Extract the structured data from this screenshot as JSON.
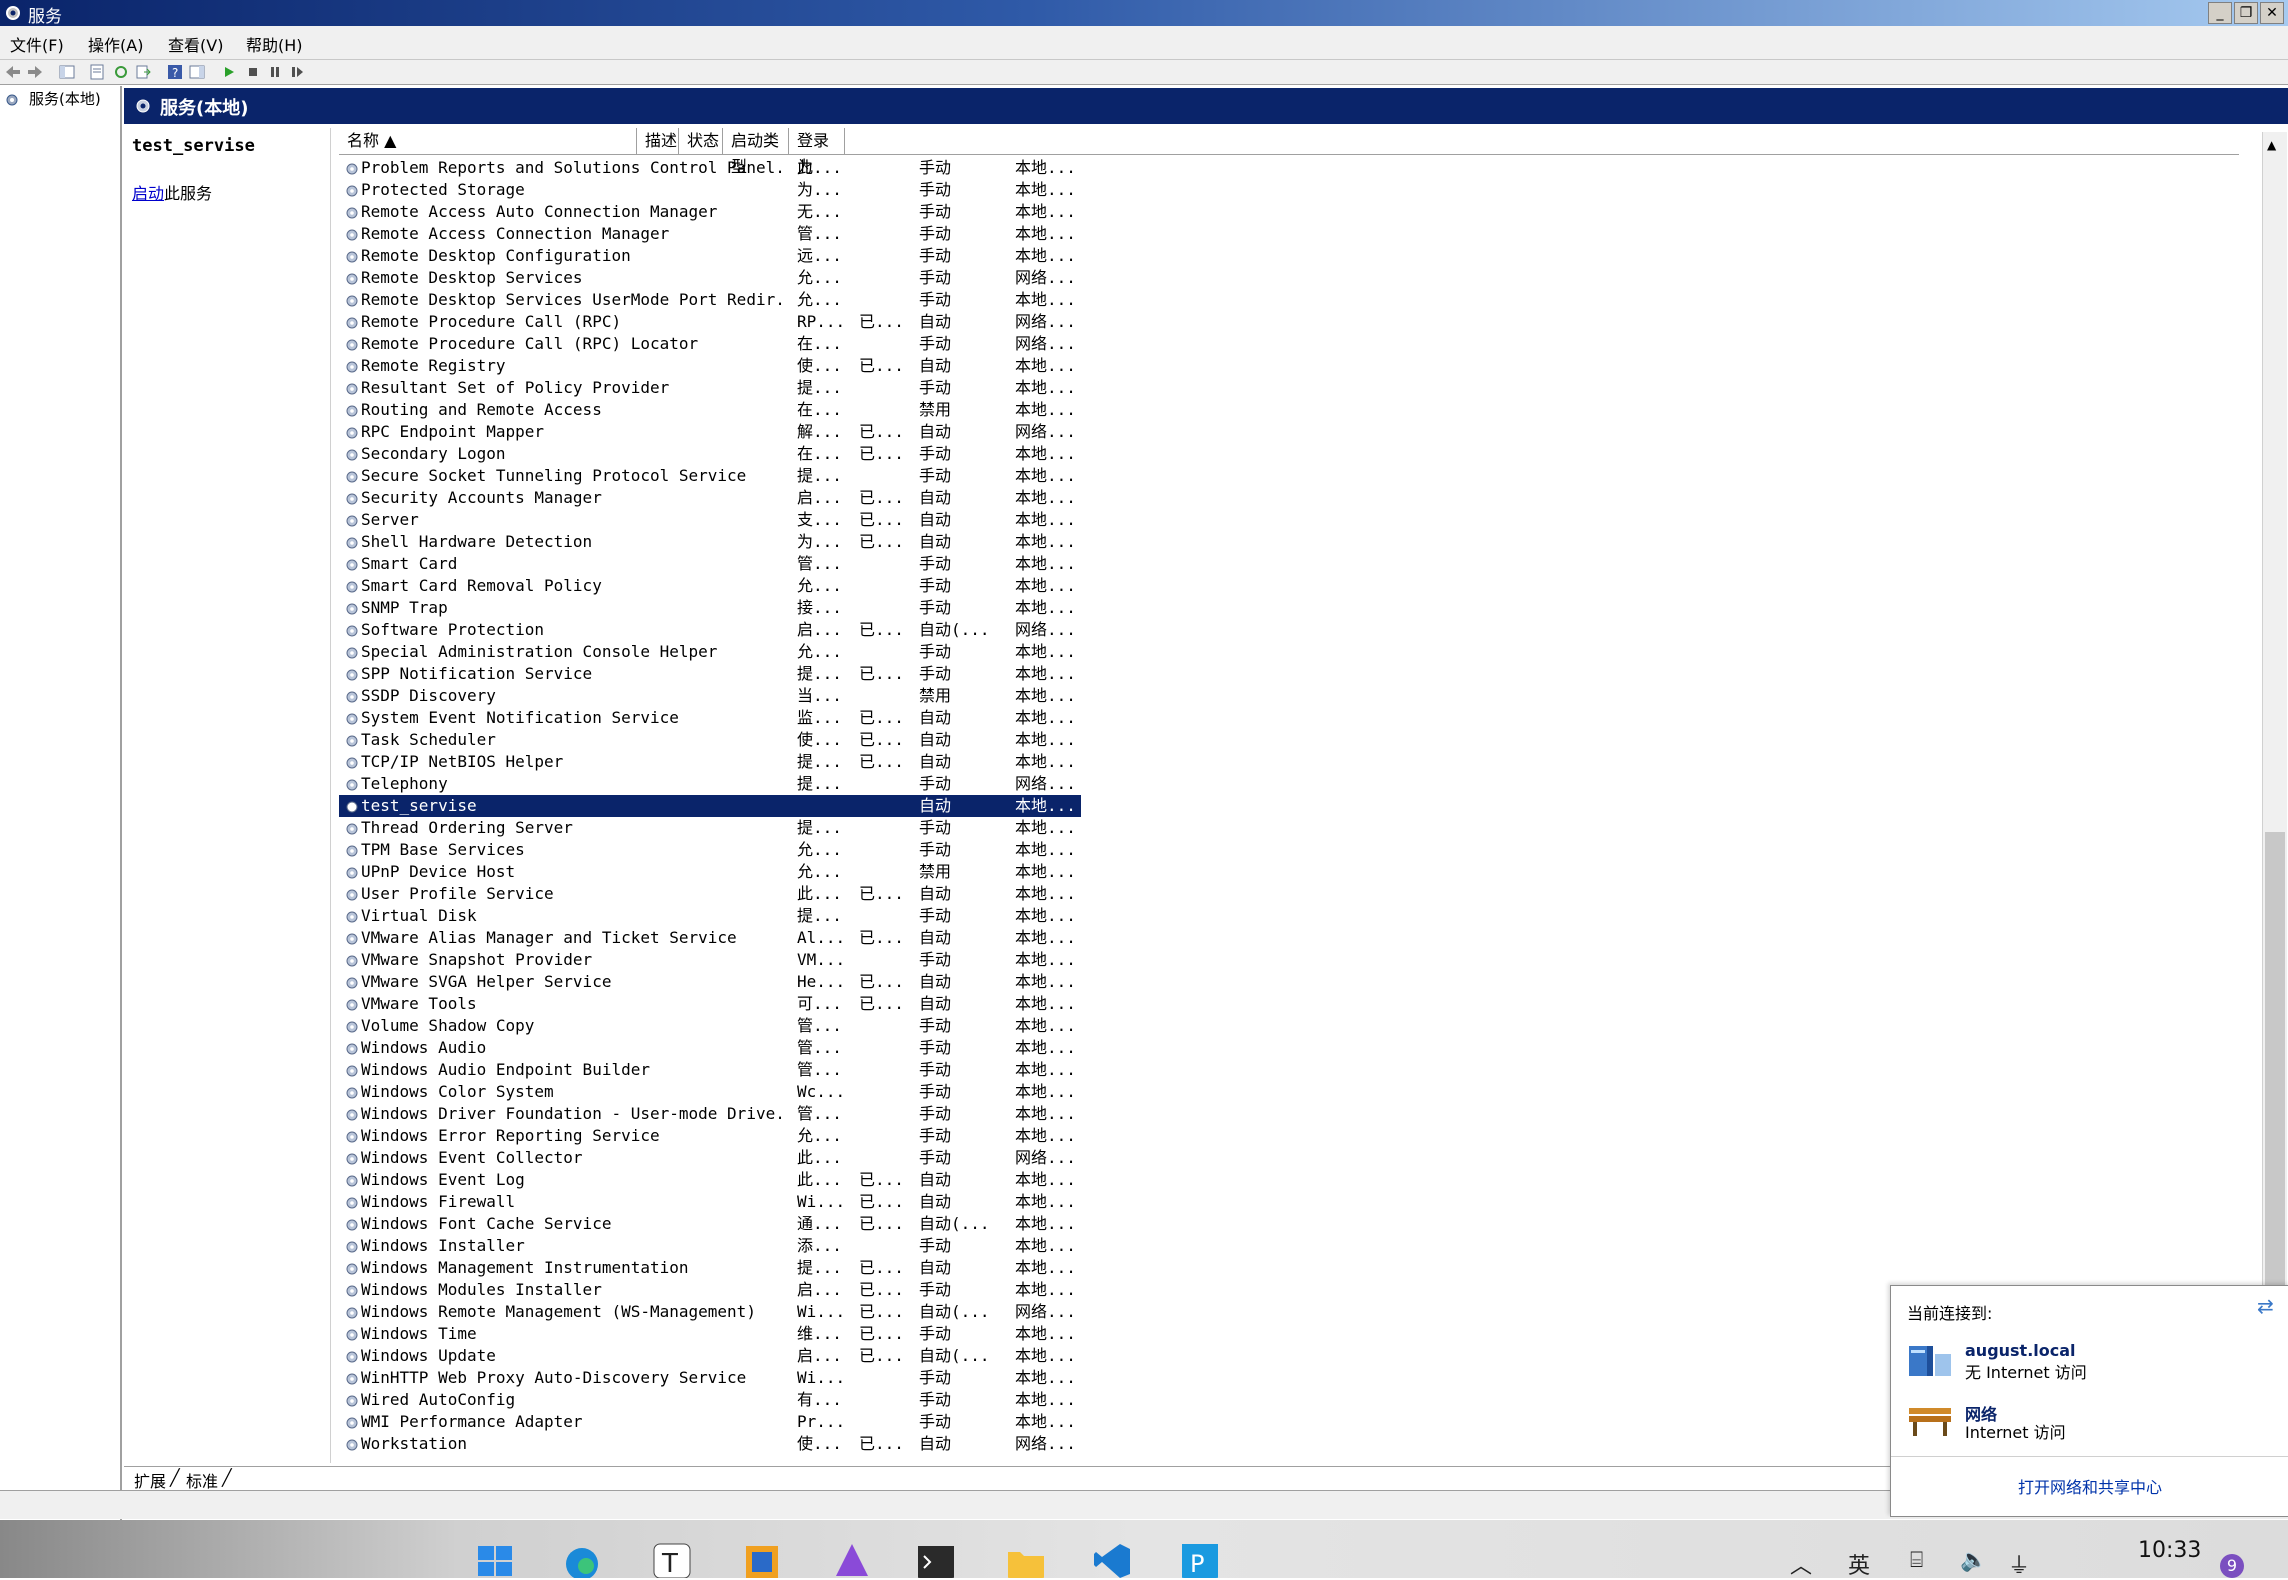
{
  "window": {
    "title": "服务",
    "controls": {
      "minimize": "_",
      "restore": "❐",
      "close": "✕"
    }
  },
  "menu": [
    "文件(F)",
    "操作(A)",
    "查看(V)",
    "帮助(H)"
  ],
  "tree": {
    "root": "服务(本地)"
  },
  "header": {
    "title": "服务(本地)"
  },
  "description": {
    "service_name": "test_servise",
    "start_link": "启动",
    "start_suffix": "此服务"
  },
  "columns": {
    "name": "名称 ▲",
    "desc": "描述",
    "status": "状态",
    "startup": "启动类型",
    "logon": "登录为"
  },
  "services": [
    {
      "name": "Problem Reports and Solutions Control Panel...",
      "desc": "此...",
      "status": "",
      "startup": "手动",
      "logon": "本地..."
    },
    {
      "name": "Protected Storage",
      "desc": "为...",
      "status": "",
      "startup": "手动",
      "logon": "本地..."
    },
    {
      "name": "Remote Access Auto Connection Manager",
      "desc": "无...",
      "status": "",
      "startup": "手动",
      "logon": "本地..."
    },
    {
      "name": "Remote Access Connection Manager",
      "desc": "管...",
      "status": "",
      "startup": "手动",
      "logon": "本地..."
    },
    {
      "name": "Remote Desktop Configuration",
      "desc": "远...",
      "status": "",
      "startup": "手动",
      "logon": "本地..."
    },
    {
      "name": "Remote Desktop Services",
      "desc": "允...",
      "status": "",
      "startup": "手动",
      "logon": "网络..."
    },
    {
      "name": "Remote Desktop Services UserMode Port Redir...",
      "desc": "允...",
      "status": "",
      "startup": "手动",
      "logon": "本地..."
    },
    {
      "name": "Remote Procedure Call (RPC)",
      "desc": "RP...",
      "status": "已...",
      "startup": "自动",
      "logon": "网络..."
    },
    {
      "name": "Remote Procedure Call (RPC) Locator",
      "desc": "在...",
      "status": "",
      "startup": "手动",
      "logon": "网络..."
    },
    {
      "name": "Remote Registry",
      "desc": "使...",
      "status": "已...",
      "startup": "自动",
      "logon": "本地..."
    },
    {
      "name": "Resultant Set of Policy Provider",
      "desc": "提...",
      "status": "",
      "startup": "手动",
      "logon": "本地..."
    },
    {
      "name": "Routing and Remote Access",
      "desc": "在...",
      "status": "",
      "startup": "禁用",
      "logon": "本地..."
    },
    {
      "name": "RPC Endpoint Mapper",
      "desc": "解...",
      "status": "已...",
      "startup": "自动",
      "logon": "网络..."
    },
    {
      "name": "Secondary Logon",
      "desc": "在...",
      "status": "已...",
      "startup": "手动",
      "logon": "本地..."
    },
    {
      "name": "Secure Socket Tunneling Protocol Service",
      "desc": "提...",
      "status": "",
      "startup": "手动",
      "logon": "本地..."
    },
    {
      "name": "Security Accounts Manager",
      "desc": "启...",
      "status": "已...",
      "startup": "自动",
      "logon": "本地..."
    },
    {
      "name": "Server",
      "desc": "支...",
      "status": "已...",
      "startup": "自动",
      "logon": "本地..."
    },
    {
      "name": "Shell Hardware Detection",
      "desc": "为...",
      "status": "已...",
      "startup": "自动",
      "logon": "本地..."
    },
    {
      "name": "Smart Card",
      "desc": "管...",
      "status": "",
      "startup": "手动",
      "logon": "本地..."
    },
    {
      "name": "Smart Card Removal Policy",
      "desc": "允...",
      "status": "",
      "startup": "手动",
      "logon": "本地..."
    },
    {
      "name": "SNMP Trap",
      "desc": "接...",
      "status": "",
      "startup": "手动",
      "logon": "本地..."
    },
    {
      "name": "Software Protection",
      "desc": "启...",
      "status": "已...",
      "startup": "自动(...",
      "logon": "网络..."
    },
    {
      "name": "Special Administration Console Helper",
      "desc": "允...",
      "status": "",
      "startup": "手动",
      "logon": "本地..."
    },
    {
      "name": "SPP Notification Service",
      "desc": "提...",
      "status": "已...",
      "startup": "手动",
      "logon": "本地..."
    },
    {
      "name": "SSDP Discovery",
      "desc": "当...",
      "status": "",
      "startup": "禁用",
      "logon": "本地..."
    },
    {
      "name": "System Event Notification Service",
      "desc": "监...",
      "status": "已...",
      "startup": "自动",
      "logon": "本地..."
    },
    {
      "name": "Task Scheduler",
      "desc": "使...",
      "status": "已...",
      "startup": "自动",
      "logon": "本地..."
    },
    {
      "name": "TCP/IP NetBIOS Helper",
      "desc": "提...",
      "status": "已...",
      "startup": "自动",
      "logon": "本地..."
    },
    {
      "name": "Telephony",
      "desc": "提...",
      "status": "",
      "startup": "手动",
      "logon": "网络..."
    },
    {
      "name": "test_servise",
      "desc": "",
      "status": "",
      "startup": "自动",
      "logon": "本地...",
      "selected": true
    },
    {
      "name": "Thread Ordering Server",
      "desc": "提...",
      "status": "",
      "startup": "手动",
      "logon": "本地..."
    },
    {
      "name": "TPM Base Services",
      "desc": "允...",
      "status": "",
      "startup": "手动",
      "logon": "本地..."
    },
    {
      "name": "UPnP Device Host",
      "desc": "允...",
      "status": "",
      "startup": "禁用",
      "logon": "本地..."
    },
    {
      "name": "User Profile Service",
      "desc": "此...",
      "status": "已...",
      "startup": "自动",
      "logon": "本地..."
    },
    {
      "name": "Virtual Disk",
      "desc": "提...",
      "status": "",
      "startup": "手动",
      "logon": "本地..."
    },
    {
      "name": "VMware Alias Manager and Ticket Service",
      "desc": "Al...",
      "status": "已...",
      "startup": "自动",
      "logon": "本地..."
    },
    {
      "name": "VMware Snapshot Provider",
      "desc": "VM...",
      "status": "",
      "startup": "手动",
      "logon": "本地..."
    },
    {
      "name": "VMware SVGA Helper Service",
      "desc": "He...",
      "status": "已...",
      "startup": "自动",
      "logon": "本地..."
    },
    {
      "name": "VMware Tools",
      "desc": "可...",
      "status": "已...",
      "startup": "自动",
      "logon": "本地..."
    },
    {
      "name": "Volume Shadow Copy",
      "desc": "管...",
      "status": "",
      "startup": "手动",
      "logon": "本地..."
    },
    {
      "name": "Windows Audio",
      "desc": "管...",
      "status": "",
      "startup": "手动",
      "logon": "本地..."
    },
    {
      "name": "Windows Audio Endpoint Builder",
      "desc": "管...",
      "status": "",
      "startup": "手动",
      "logon": "本地..."
    },
    {
      "name": "Windows Color System",
      "desc": "Wc...",
      "status": "",
      "startup": "手动",
      "logon": "本地..."
    },
    {
      "name": "Windows Driver Foundation - User-mode Drive...",
      "desc": "管...",
      "status": "",
      "startup": "手动",
      "logon": "本地..."
    },
    {
      "name": "Windows Error Reporting Service",
      "desc": "允...",
      "status": "",
      "startup": "手动",
      "logon": "本地..."
    },
    {
      "name": "Windows Event Collector",
      "desc": "此...",
      "status": "",
      "startup": "手动",
      "logon": "网络..."
    },
    {
      "name": "Windows Event Log",
      "desc": "此...",
      "status": "已...",
      "startup": "自动",
      "logon": "本地..."
    },
    {
      "name": "Windows Firewall",
      "desc": "Wi...",
      "status": "已...",
      "startup": "自动",
      "logon": "本地..."
    },
    {
      "name": "Windows Font Cache Service",
      "desc": "通...",
      "status": "已...",
      "startup": "自动(...",
      "logon": "本地..."
    },
    {
      "name": "Windows Installer",
      "desc": "添...",
      "status": "",
      "startup": "手动",
      "logon": "本地..."
    },
    {
      "name": "Windows Management Instrumentation",
      "desc": "提...",
      "status": "已...",
      "startup": "自动",
      "logon": "本地..."
    },
    {
      "name": "Windows Modules Installer",
      "desc": "启...",
      "status": "已...",
      "startup": "手动",
      "logon": "本地..."
    },
    {
      "name": "Windows Remote Management (WS-Management)",
      "desc": "Wi...",
      "status": "已...",
      "startup": "自动(...",
      "logon": "网络..."
    },
    {
      "name": "Windows Time",
      "desc": "维...",
      "status": "已...",
      "startup": "手动",
      "logon": "本地..."
    },
    {
      "name": "Windows Update",
      "desc": "启...",
      "status": "已...",
      "startup": "自动(...",
      "logon": "本地..."
    },
    {
      "name": "WinHTTP Web Proxy Auto-Discovery Service",
      "desc": "Wi...",
      "status": "",
      "startup": "手动",
      "logon": "本地..."
    },
    {
      "name": "Wired AutoConfig",
      "desc": "有...",
      "status": "",
      "startup": "手动",
      "logon": "本地..."
    },
    {
      "name": "WMI Performance Adapter",
      "desc": "Pr...",
      "status": "",
      "startup": "手动",
      "logon": "本地..."
    },
    {
      "name": "Workstation",
      "desc": "使...",
      "status": "已...",
      "startup": "自动",
      "logon": "网络..."
    }
  ],
  "tabs": {
    "extended": "扩展",
    "standard": "标准"
  },
  "network_popup": {
    "header": "当前连接到:",
    "net1_name": "august.local",
    "net1_status": "无 Internet 访问",
    "net2_name": "网络",
    "net2_status": "Internet 访问",
    "link": "打开网络和共享中心"
  },
  "taskbar": {
    "tray_ime": "英",
    "clock": "10:33",
    "badge": "9",
    "apps": [
      "start",
      "edge",
      "typora",
      "vmware",
      "app-purple",
      "terminal",
      "explorer",
      "vscode",
      "pycharm"
    ]
  },
  "colors": {
    "selection": "#0a246a",
    "header_band": "#0a246a",
    "link": "#0000cc"
  }
}
